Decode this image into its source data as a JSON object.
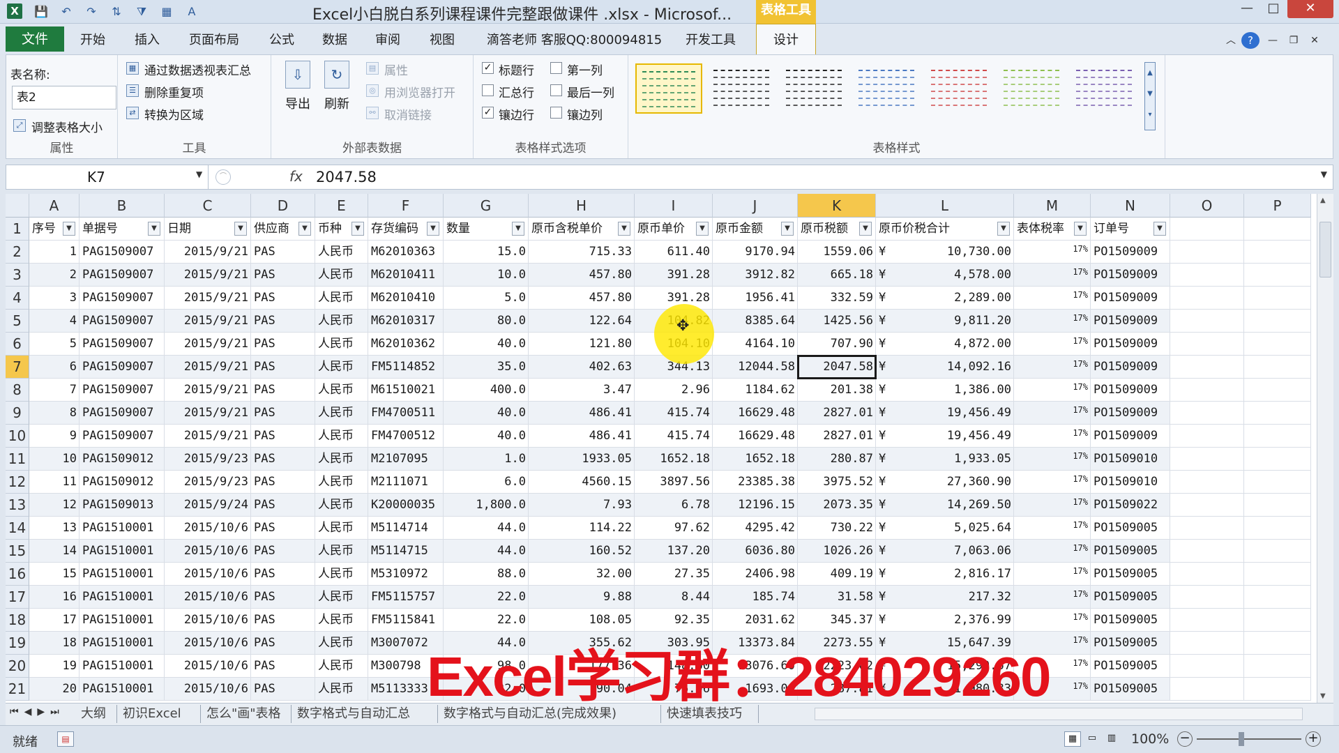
{
  "window": {
    "title": "Excel小白脱白系列课程课件完整跟做课件 .xlsx - Microsof...",
    "context_tab": "表格工具",
    "qa_icons": [
      "save-icon",
      "undo-icon",
      "redo-icon",
      "sort-icon",
      "filter-icon",
      "table-icon",
      "font-icon"
    ]
  },
  "tabs": {
    "file": "文件",
    "items": [
      "开始",
      "插入",
      "页面布局",
      "公式",
      "数据",
      "审阅",
      "视图",
      "滴答老师 客服QQ:800094815",
      "开发工具"
    ],
    "design": "设计"
  },
  "ribbon": {
    "properties": {
      "table_name_label": "表名称:",
      "table_name": "表2",
      "resize": "调整表格大小",
      "group": "属性"
    },
    "tools": {
      "pivot": "通过数据透视表汇总",
      "remove_dup": "删除重复项",
      "convert": "转换为区域",
      "group": "工具"
    },
    "external": {
      "export": "导出",
      "refresh": "刷新",
      "properties": "属性",
      "open_browser": "用浏览器打开",
      "unlink": "取消链接",
      "group": "外部表数据"
    },
    "options": {
      "header_row": "标题行",
      "first_col": "第一列",
      "total_row": "汇总行",
      "last_col": "最后一列",
      "banded_rows": "镶边行",
      "banded_cols": "镶边列",
      "group": "表格样式选项",
      "header_row_checked": true,
      "first_col_checked": false,
      "total_row_checked": false,
      "last_col_checked": false,
      "banded_rows_checked": true,
      "banded_cols_checked": false
    },
    "styles": {
      "group": "表格样式",
      "colors": [
        "#2e8b57",
        "#222222",
        "#222222",
        "#4a78c2",
        "#d04a4a",
        "#8fbf4f",
        "#7a5fb0"
      ]
    }
  },
  "formula": {
    "namebox": "K7",
    "fx": "fx",
    "value": "2047.58"
  },
  "columns": [
    "A",
    "B",
    "C",
    "D",
    "E",
    "F",
    "G",
    "H",
    "I",
    "J",
    "K",
    "L",
    "M",
    "N",
    "O",
    "P"
  ],
  "headers": [
    "序号",
    "单据号",
    "日期",
    "供应商",
    "币种",
    "存货编码",
    "数量",
    "原币含税单价",
    "原币单价",
    "原币金额",
    "原币税额",
    "原币价税合计",
    "表体税率",
    "订单号"
  ],
  "rows": [
    [
      "1",
      "PAG1509007",
      "2015/9/21",
      "PAS",
      "人民币",
      "M62010363",
      "15.0",
      "715.33",
      "611.40",
      "9170.94",
      "1559.06",
      "¥",
      "10,730.00",
      "17%",
      "PO1509009"
    ],
    [
      "2",
      "PAG1509007",
      "2015/9/21",
      "PAS",
      "人民币",
      "M62010411",
      "10.0",
      "457.80",
      "391.28",
      "3912.82",
      "665.18",
      "¥",
      "4,578.00",
      "17%",
      "PO1509009"
    ],
    [
      "3",
      "PAG1509007",
      "2015/9/21",
      "PAS",
      "人民币",
      "M62010410",
      "5.0",
      "457.80",
      "391.28",
      "1956.41",
      "332.59",
      "¥",
      "2,289.00",
      "17%",
      "PO1509009"
    ],
    [
      "4",
      "PAG1509007",
      "2015/9/21",
      "PAS",
      "人民币",
      "M62010317",
      "80.0",
      "122.64",
      "104.82",
      "8385.64",
      "1425.56",
      "¥",
      "9,811.20",
      "17%",
      "PO1509009"
    ],
    [
      "5",
      "PAG1509007",
      "2015/9/21",
      "PAS",
      "人民币",
      "M62010362",
      "40.0",
      "121.80",
      "104.10",
      "4164.10",
      "707.90",
      "¥",
      "4,872.00",
      "17%",
      "PO1509009"
    ],
    [
      "6",
      "PAG1509007",
      "2015/9/21",
      "PAS",
      "人民币",
      "FM5114852",
      "35.0",
      "402.63",
      "344.13",
      "12044.58",
      "2047.58",
      "¥",
      "14,092.16",
      "17%",
      "PO1509009"
    ],
    [
      "7",
      "PAG1509007",
      "2015/9/21",
      "PAS",
      "人民币",
      "M61510021",
      "400.0",
      "3.47",
      "2.96",
      "1184.62",
      "201.38",
      "¥",
      "1,386.00",
      "17%",
      "PO1509009"
    ],
    [
      "8",
      "PAG1509007",
      "2015/9/21",
      "PAS",
      "人民币",
      "FM4700511",
      "40.0",
      "486.41",
      "415.74",
      "16629.48",
      "2827.01",
      "¥",
      "19,456.49",
      "17%",
      "PO1509009"
    ],
    [
      "9",
      "PAG1509007",
      "2015/9/21",
      "PAS",
      "人民币",
      "FM4700512",
      "40.0",
      "486.41",
      "415.74",
      "16629.48",
      "2827.01",
      "¥",
      "19,456.49",
      "17%",
      "PO1509009"
    ],
    [
      "10",
      "PAG1509012",
      "2015/9/23",
      "PAS",
      "人民币",
      "M2107095",
      "1.0",
      "1933.05",
      "1652.18",
      "1652.18",
      "280.87",
      "¥",
      "1,933.05",
      "17%",
      "PO1509010"
    ],
    [
      "11",
      "PAG1509012",
      "2015/9/23",
      "PAS",
      "人民币",
      "M2111071",
      "6.0",
      "4560.15",
      "3897.56",
      "23385.38",
      "3975.52",
      "¥",
      "27,360.90",
      "17%",
      "PO1509010"
    ],
    [
      "12",
      "PAG1509013",
      "2015/9/24",
      "PAS",
      "人民币",
      "K20000035",
      "1,800.0",
      "7.93",
      "6.78",
      "12196.15",
      "2073.35",
      "¥",
      "14,269.50",
      "17%",
      "PO1509022"
    ],
    [
      "13",
      "PAG1510001",
      "2015/10/6",
      "PAS",
      "人民币",
      "M5114714",
      "44.0",
      "114.22",
      "97.62",
      "4295.42",
      "730.22",
      "¥",
      "5,025.64",
      "17%",
      "PO1509005"
    ],
    [
      "14",
      "PAG1510001",
      "2015/10/6",
      "PAS",
      "人民币",
      "M5114715",
      "44.0",
      "160.52",
      "137.20",
      "6036.80",
      "1026.26",
      "¥",
      "7,063.06",
      "17%",
      "PO1509005"
    ],
    [
      "15",
      "PAG1510001",
      "2015/10/6",
      "PAS",
      "人民币",
      "M5310972",
      "88.0",
      "32.00",
      "27.35",
      "2406.98",
      "409.19",
      "¥",
      "2,816.17",
      "17%",
      "PO1509005"
    ],
    [
      "16",
      "PAG1510001",
      "2015/10/6",
      "PAS",
      "人民币",
      "FM5115757",
      "22.0",
      "9.88",
      "8.44",
      "185.74",
      "31.58",
      "¥",
      "217.32",
      "17%",
      "PO1509005"
    ],
    [
      "17",
      "PAG1510001",
      "2015/10/6",
      "PAS",
      "人民币",
      "FM5115841",
      "22.0",
      "108.05",
      "92.35",
      "2031.62",
      "345.37",
      "¥",
      "2,376.99",
      "17%",
      "PO1509005"
    ],
    [
      "18",
      "PAG1510001",
      "2015/10/6",
      "PAS",
      "人民币",
      "M3007072",
      "44.0",
      "355.62",
      "303.95",
      "13373.84",
      "2273.55",
      "¥",
      "15,647.39",
      "17%",
      "PO1509005"
    ],
    [
      "19",
      "PAG1510001",
      "2015/10/6",
      "PAS",
      "人民币",
      "M300798",
      "98.0",
      "177.36",
      "148.60",
      "13076.60",
      "2223.02",
      "¥",
      "15,299.67",
      "17%",
      "PO1509005"
    ],
    [
      "20",
      "PAG1510001",
      "2015/10/6",
      "PAS",
      "人民币",
      "M5113333",
      "22.0",
      "90.04",
      "76.96",
      "1693.08",
      "287.81",
      "¥",
      "1,980.83",
      "17%",
      "PO1509005"
    ]
  ],
  "selection": {
    "column": "K",
    "row": 7
  },
  "watermark": "Excel学习群：284029260",
  "sheets": [
    "大纲",
    "初识Excel",
    "怎么\"画\"表格",
    "数字格式与自动汇总",
    "数字格式与自动汇总(完成效果)",
    "快速填表技巧"
  ],
  "status": {
    "ready": "就绪",
    "zoom": "100%"
  }
}
